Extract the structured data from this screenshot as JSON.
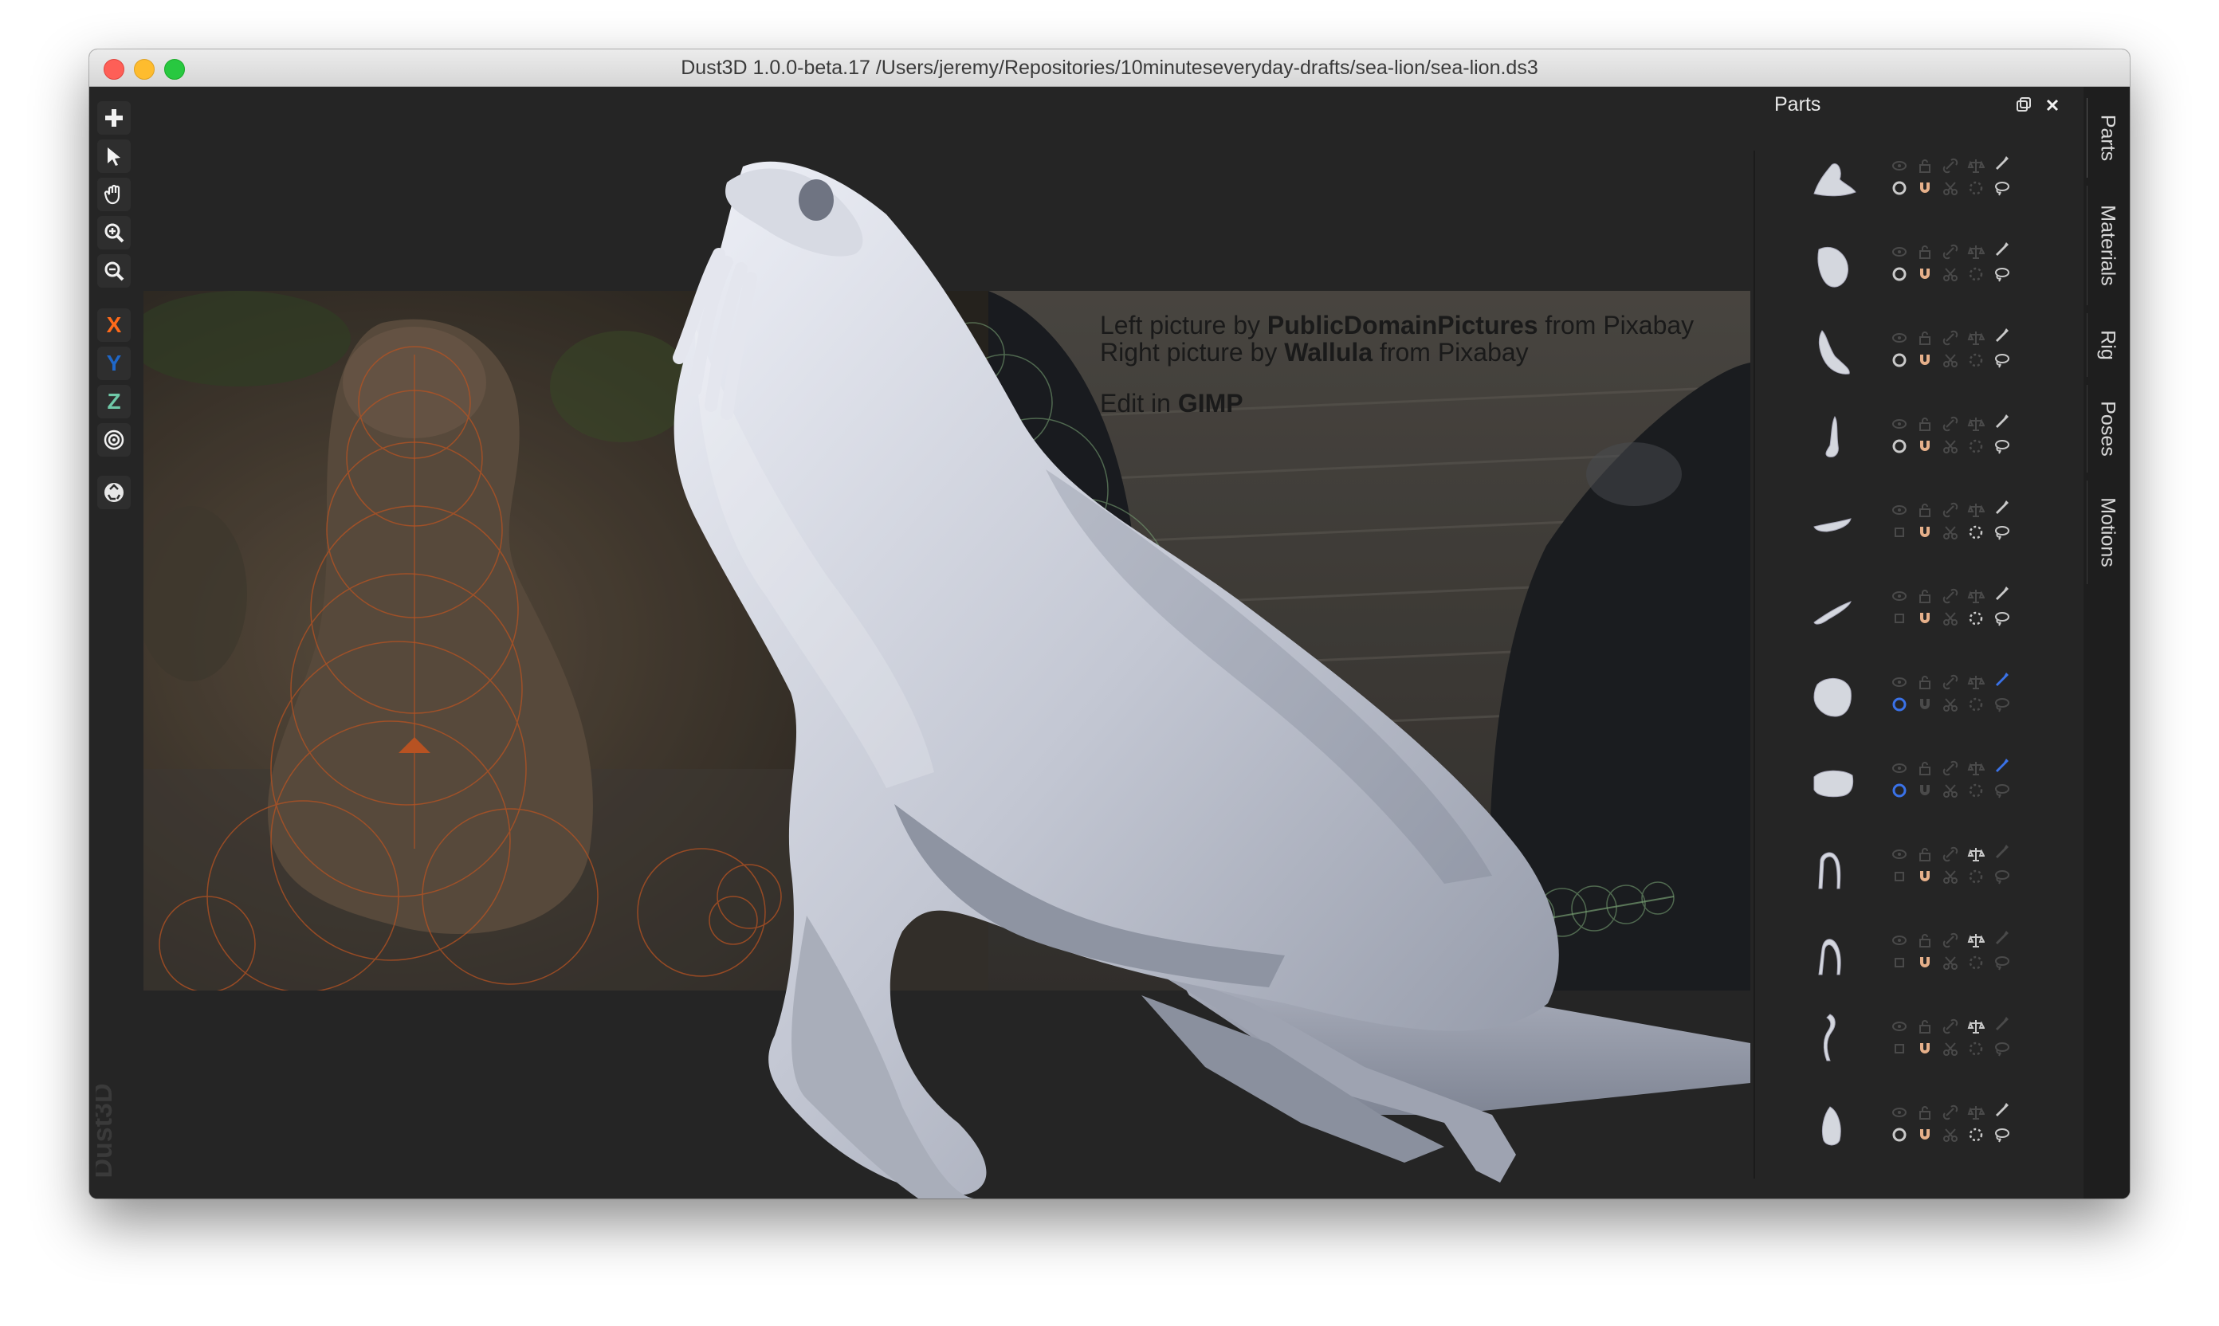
{
  "window": {
    "title": "Dust3D 1.0.0-beta.17 /Users/jeremy/Repositories/10minuteseveryday-drafts/sea-lion/sea-lion.ds3"
  },
  "toolbar": {
    "tools": [
      {
        "name": "add-icon"
      },
      {
        "name": "select-pointer-icon"
      },
      {
        "name": "hand-pan-icon"
      },
      {
        "name": "zoom-in-icon"
      },
      {
        "name": "zoom-out-icon"
      }
    ],
    "axis_x": "X",
    "axis_y": "Y",
    "axis_z": "Z",
    "axis_x_color": "#ff6a1a",
    "axis_y_color": "#1f67c8",
    "axis_z_color": "#6fc9a8",
    "radial_tool": "target-icon",
    "regenerate_tool": "recycle-icon"
  },
  "credits": {
    "line1_prefix": "Left picture by ",
    "line1_author": "PublicDomainPictures",
    "line1_suffix": " from Pixabay",
    "line2_prefix": "Right picture by ",
    "line2_author": "Wallula",
    "line2_suffix": " from Pixabay",
    "line3_prefix": "Edit in ",
    "line3_tool": "GIMP"
  },
  "watermark": "Dust3D",
  "parts_panel": {
    "title": "Parts",
    "float_icon": "float-window-icon",
    "close_icon": "close-icon",
    "parts": [
      {
        "thumb": "head-neck",
        "highlight": false
      },
      {
        "thumb": "body-blob",
        "highlight": false
      },
      {
        "thumb": "flipper-long",
        "highlight": false
      },
      {
        "thumb": "foot-small",
        "highlight": false
      },
      {
        "thumb": "whisker-flat",
        "highlight": false
      },
      {
        "thumb": "whisker-curve",
        "highlight": false
      },
      {
        "thumb": "torso-round",
        "highlight": true
      },
      {
        "thumb": "torso-flat",
        "highlight": true
      },
      {
        "thumb": "curve-arc",
        "highlight": false
      },
      {
        "thumb": "curve-arc-2",
        "highlight": false
      },
      {
        "thumb": "curve-hook",
        "highlight": false
      },
      {
        "thumb": "nose-drop",
        "highlight": false
      }
    ]
  },
  "side_tabs": [
    "Parts",
    "Materials",
    "Rig",
    "Poses",
    "Motions"
  ],
  "colors": {
    "accent_blue": "#3a72e8",
    "orange_guides": "#e0652a",
    "model_gray": "#c8ccd8"
  }
}
